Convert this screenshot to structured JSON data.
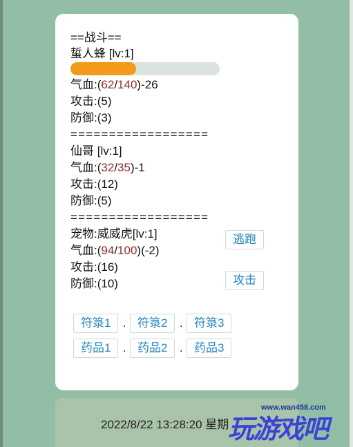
{
  "battle": {
    "header": "==战斗==",
    "separator": "==================",
    "enemy": {
      "name": "蜇人蜂 [lv:1]",
      "hp_label": "气血:(",
      "hp_current": "62",
      "hp_slash": "/",
      "hp_max": "140",
      "hp_suffix": ")-26",
      "hp_fraction": 0.44,
      "attack": "攻击:(5)",
      "defense": "防御:(3)"
    },
    "player": {
      "name": "仙哥 [lv:1]",
      "hp_label": "气血:(",
      "hp_current": "32",
      "hp_slash": "/",
      "hp_max": "35",
      "hp_suffix": ")-1",
      "attack": "攻击:(12)",
      "defense": "防御:(5)"
    },
    "pet": {
      "name": "宠物:威威虎[lv:1]",
      "hp_label": "气血:(",
      "hp_current": "94",
      "hp_slash": "/",
      "hp_max": "100",
      "hp_suffix": ")(-2)",
      "attack": "攻击:(16)",
      "defense": "防御:(10)"
    },
    "actions": {
      "flee": "逃跑",
      "attack": "攻击"
    },
    "items": {
      "talismans": [
        "符箓1",
        "符箓2",
        "符箓3"
      ],
      "potions": [
        "药品1",
        "药品2",
        "药品3"
      ],
      "dot": "."
    }
  },
  "footer": {
    "timestamp": "2022/8/22 13:28:20 星期"
  },
  "watermark": {
    "site": "www.wan458.com",
    "text": "玩游戏吧"
  },
  "colors": {
    "background": "#93bea6",
    "hp_bar": "#f39a1b",
    "hp_numbers": "#9b2a2a",
    "button_text": "#1e88c8"
  }
}
